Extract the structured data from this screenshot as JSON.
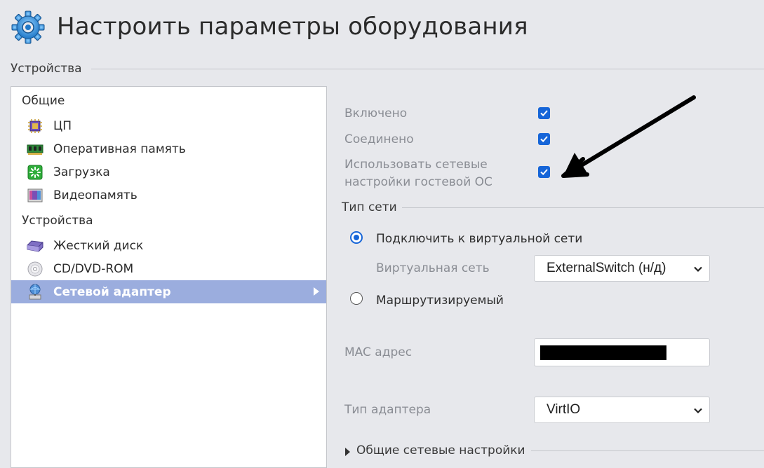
{
  "window": {
    "title": "Настроить параметры оборудования",
    "icon": "gear-icon"
  },
  "section": {
    "devices_label": "Устройства"
  },
  "sidebar": {
    "group_general": "Общие",
    "general_items": [
      {
        "label": "ЦП",
        "icon": "cpu-icon"
      },
      {
        "label": "Оперативная память",
        "icon": "memory-icon"
      },
      {
        "label": "Загрузка",
        "icon": "boot-icon"
      },
      {
        "label": "Видеопамять",
        "icon": "video-memory-icon"
      }
    ],
    "group_devices": "Устройства",
    "device_items": [
      {
        "label": "Жесткий диск",
        "icon": "hard-disk-icon"
      },
      {
        "label": "CD/DVD-ROM",
        "icon": "cd-rom-icon"
      },
      {
        "label": "Сетевой адаптер",
        "icon": "network-adapter-icon",
        "selected": true
      }
    ]
  },
  "settings": {
    "enabled_label": "Включено",
    "enabled_checked": true,
    "connected_label": "Соединено",
    "connected_checked": true,
    "guest_os_label_line1": "Использовать сетевые",
    "guest_os_label_line2": "настройки гостевой ОС",
    "guest_os_checked": true,
    "network_type_legend": "Тип сети",
    "radio_virtual_label": "Подключить к виртуальной сети",
    "radio_virtual_selected": true,
    "virtual_network_label": "Виртуальная сеть",
    "virtual_network_value": "ExternalSwitch (н/д)",
    "radio_routed_label": "Маршрутизируемый",
    "radio_routed_selected": false,
    "mac_label": "MAC адрес",
    "adapter_type_label": "Тип адаптера",
    "adapter_type_value": "VirtIO",
    "general_network_settings_label": "Общие сетевые настройки"
  },
  "colors": {
    "accent": "#1665d8",
    "selection": "#9badde",
    "background": "#e7e8ec",
    "annotation_arrow": "#000000"
  }
}
